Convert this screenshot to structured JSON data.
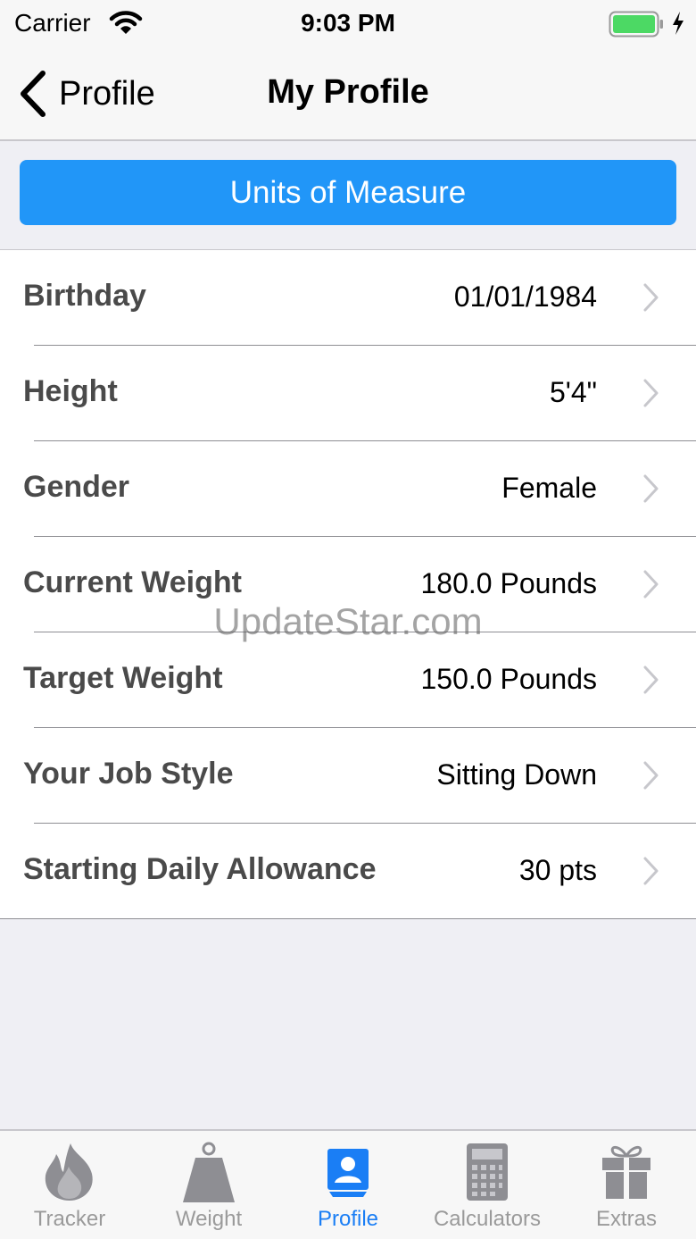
{
  "status_bar": {
    "carrier": "Carrier",
    "time": "9:03 PM"
  },
  "nav": {
    "back_label": "Profile",
    "title": "My Profile"
  },
  "units_button": {
    "label": "Units of Measure"
  },
  "rows": [
    {
      "label": "Birthday",
      "value": "01/01/1984"
    },
    {
      "label": "Height",
      "value": "5'4\""
    },
    {
      "label": "Gender",
      "value": "Female"
    },
    {
      "label": "Current Weight",
      "value": "180.0 Pounds"
    },
    {
      "label": "Target Weight",
      "value": "150.0 Pounds"
    },
    {
      "label": "Your Job Style",
      "value": "Sitting Down"
    },
    {
      "label": "Starting Daily Allowance",
      "value": "30 pts"
    }
  ],
  "watermark": "UpdateStar.com",
  "tabs": [
    {
      "label": "Tracker",
      "icon": "flame-icon",
      "active": false
    },
    {
      "label": "Weight",
      "icon": "weight-icon",
      "active": false
    },
    {
      "label": "Profile",
      "icon": "profile-icon",
      "active": true
    },
    {
      "label": "Calculators",
      "icon": "calculator-icon",
      "active": false
    },
    {
      "label": "Extras",
      "icon": "gift-icon",
      "active": false
    }
  ],
  "colors": {
    "accent": "#2196f8",
    "tab_active": "#1a7ef5",
    "tab_inactive": "#9a9a9a",
    "battery": "#4cd964"
  }
}
